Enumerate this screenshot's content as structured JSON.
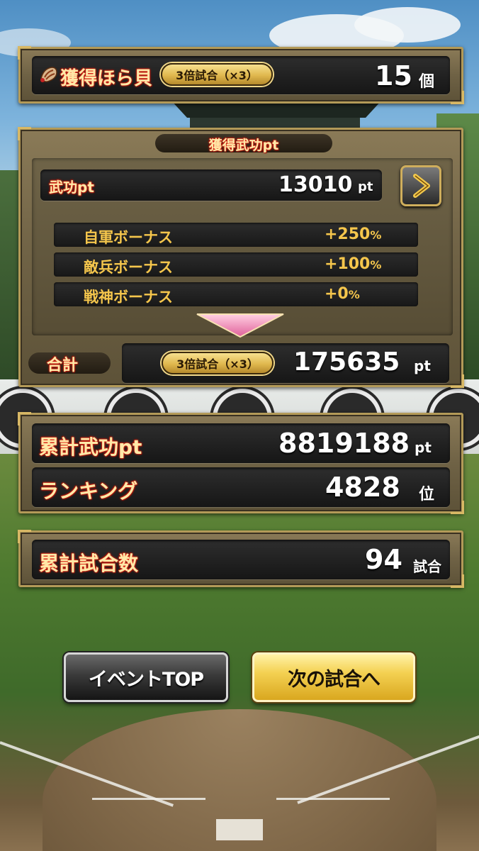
{
  "shell": {
    "title_label": "獲得ほら貝",
    "multiplier_badge": "3倍試合（×3）",
    "shell_value": "15",
    "shell_unit": "個"
  },
  "merit": {
    "section_title": "獲得武功pt",
    "merit_label": "武功pt",
    "merit_value": "13010",
    "merit_unit": "pt",
    "bonuses": [
      {
        "label": "自軍ボーナス",
        "value": "+250",
        "unit": "%"
      },
      {
        "label": "敵兵ボーナス",
        "value": "+100",
        "unit": "%"
      },
      {
        "label": "戦神ボーナス",
        "value": "+0",
        "unit": "%"
      }
    ],
    "total_label": "合計",
    "total_badge": "3倍試合（×3）",
    "total_value": "175635",
    "total_unit": "pt"
  },
  "cumulative": {
    "merit_label": "累計武功pt",
    "merit_value": "8819188",
    "merit_unit": "pt",
    "rank_label": "ランキング",
    "rank_value": "4828",
    "rank_unit": "位"
  },
  "games": {
    "label": "累計試合数",
    "value": "94",
    "unit": "試合"
  },
  "buttons": {
    "event_top": "イベントTOP",
    "next_match": "次の試合へ"
  },
  "icons": {
    "shell": "conch-shell-icon",
    "arrow": "chevron-right-icon",
    "down": "down-triangle-icon"
  },
  "colors": {
    "gold_text": "#f5c64c",
    "frame_gold": "#b39a58",
    "next_button": "#f0c93e",
    "down_arrow": "#f28fb5"
  }
}
